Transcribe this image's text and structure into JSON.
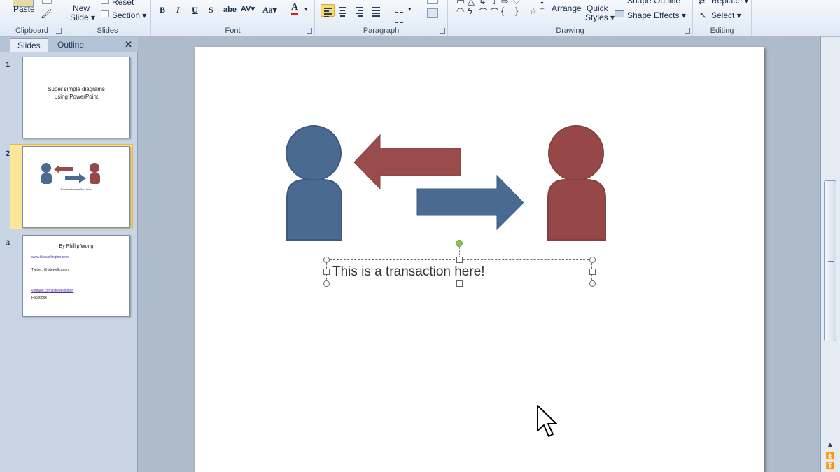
{
  "ribbon": {
    "clipboard": {
      "paste_label": "Paste",
      "group_label": "Clipboard"
    },
    "slides": {
      "new_slide_line1": "New",
      "new_slide_line2": "Slide",
      "reset_label": "Reset",
      "section_label": "Section",
      "group_label": "Slides"
    },
    "font": {
      "group_label": "Font",
      "bold": "B",
      "italic": "I",
      "underline": "U",
      "strike": "S",
      "shadow": "abe",
      "spacing": "AV",
      "case": "Aa",
      "color": "A"
    },
    "paragraph": {
      "group_label": "Paragraph"
    },
    "drawing": {
      "arrange_label": "Arrange",
      "quick_styles_line1": "Quick",
      "quick_styles_line2": "Styles",
      "shape_outline_label": "Shape Outline",
      "shape_effects_label": "Shape Effects",
      "group_label": "Drawing"
    },
    "editing": {
      "replace_label": "Replace",
      "select_label": "Select",
      "group_label": "Editing"
    }
  },
  "pane": {
    "tabs": [
      "Slides",
      "Outline"
    ],
    "active_tab": "Slides",
    "thumbnails": [
      {
        "number": "1",
        "title": "Super simple diagrams using PowerPoint"
      },
      {
        "number": "2",
        "caption": "This is a transaction here!"
      },
      {
        "number": "3",
        "title": "By Phillip Wong",
        "lines": [
          "www.bitewellington.com",
          "Twitter: @bitewellington",
          "youtube.com/bitewellington",
          "Facebook"
        ]
      }
    ],
    "selected_slide": "2"
  },
  "slide": {
    "textbox_text": "This is a transaction here!",
    "colors": {
      "blue_person": "#4a6a92",
      "red_person": "#964848",
      "red_arrow": "#9a4c4c",
      "blue_arrow": "#4a6a92"
    }
  },
  "icons": [
    "paste-icon",
    "format-painter-icon",
    "new-slide-icon",
    "reset-icon",
    "section-icon",
    "font-color-icon",
    "align-left-icon",
    "align-center-icon",
    "align-right-icon",
    "justify-icon",
    "columns-icon",
    "shapes-gallery-icon",
    "shape-outline-icon",
    "shape-effects-icon",
    "replace-icon",
    "select-icon",
    "close-pane-icon",
    "mouse-cursor-icon"
  ]
}
